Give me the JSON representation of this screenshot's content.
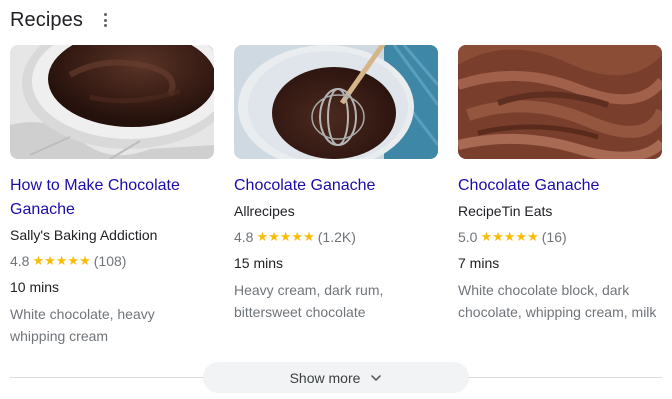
{
  "header": {
    "title": "Recipes"
  },
  "cards": [
    {
      "title_line1": "How to Make Chocolate",
      "title_line2": "Ganache",
      "source": "Sally's Baking Addiction",
      "rating": "4.8",
      "stars": "★★★★★",
      "reviews": "(108)",
      "time": "10 mins",
      "ingredients_line1": "White chocolate, heavy",
      "ingredients_line2": "whipping cream"
    },
    {
      "title_line1": "Chocolate Ganache",
      "title_line2": "",
      "source": "Allrecipes",
      "rating": "4.8",
      "stars": "★★★★★",
      "reviews": "(1.2K)",
      "time": "15 mins",
      "ingredients_line1": "Heavy cream, dark rum,",
      "ingredients_line2": "bittersweet chocolate"
    },
    {
      "title_line1": "Chocolate Ganache",
      "title_line2": "",
      "source": "RecipeTin Eats",
      "rating": "5.0",
      "stars": "★★★★★",
      "reviews": "(16)",
      "time": "7 mins",
      "ingredients_line1": "White chocolate block, dark",
      "ingredients_line2": "chocolate, whipping cream, milk"
    }
  ],
  "footer": {
    "show_more_label": "Show more"
  },
  "colors": {
    "link": "#1a0dab",
    "star": "#fbbc04",
    "muted": "#70757a"
  }
}
